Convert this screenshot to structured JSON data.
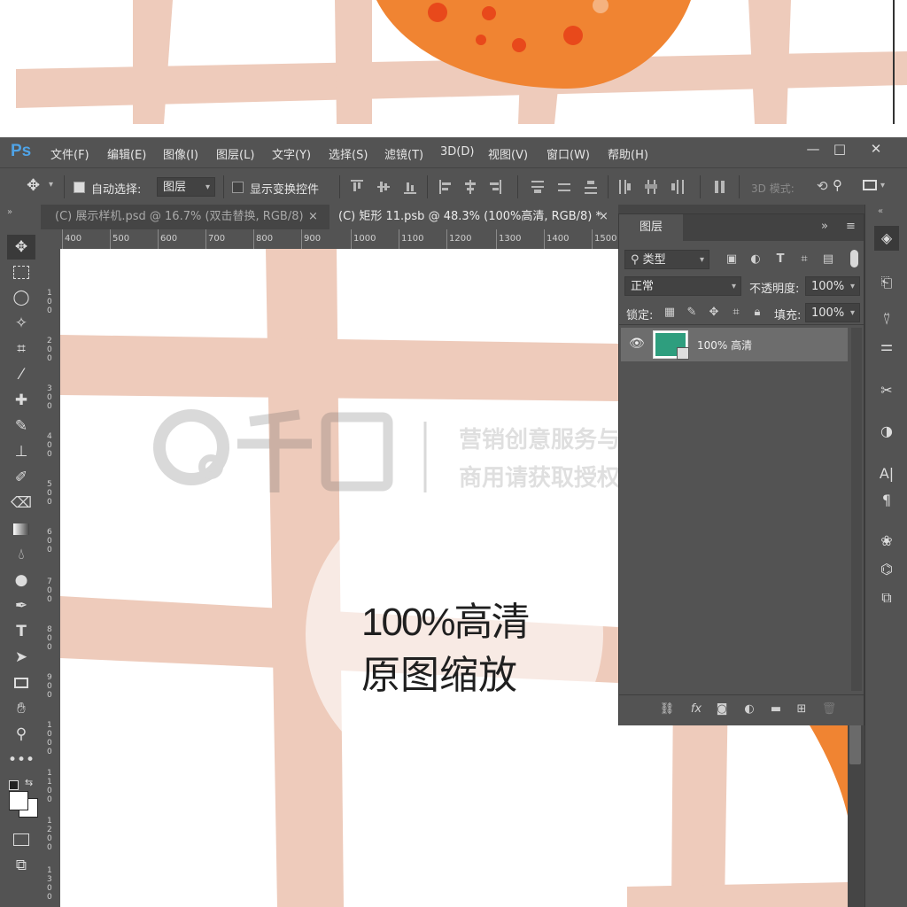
{
  "menubar": {
    "logo": "Ps",
    "items": [
      "文件(F)",
      "编辑(E)",
      "图像(I)",
      "图层(L)",
      "文字(Y)",
      "选择(S)",
      "滤镜(T)",
      "3D(D)",
      "视图(V)",
      "窗口(W)",
      "帮助(H)"
    ],
    "window_controls": [
      "—",
      "□",
      "✕"
    ]
  },
  "options": {
    "auto_select_label": "自动选择:",
    "auto_select_checked": true,
    "auto_select_value": "图层",
    "show_transform_label": "显示变换控件",
    "show_transform_checked": false,
    "mode_3d_label": "3D 模式:"
  },
  "tabs": [
    {
      "label": "(C) 展示样机.psd @ 16.7% (双击替换, RGB/8)",
      "close": "×",
      "active": false
    },
    {
      "label": "(C) 矩形 11.psb @ 48.3% (100%高清, RGB/8) *",
      "close": "×",
      "active": true
    }
  ],
  "ruler": {
    "h_ticks": [
      "400",
      "500",
      "600",
      "700",
      "800",
      "900",
      "1000",
      "1100",
      "1200",
      "1300",
      "1400",
      "1500"
    ],
    "v_ticks": [
      "100",
      "200",
      "300",
      "400",
      "500",
      "600",
      "700",
      "800",
      "900",
      "1000",
      "1100",
      "1200",
      "1300"
    ]
  },
  "canvas": {
    "headline": "100%高清",
    "subline": "原图缩放",
    "watermark_brand": "千图",
    "watermark_line1": "营销创意服务与协作平台",
    "watermark_line2": "商用请获取授权"
  },
  "layers_panel": {
    "title": "图层",
    "filter_label": "类型",
    "blend_mode": "正常",
    "opacity_label": "不透明度:",
    "opacity_value": "100%",
    "lock_label": "锁定:",
    "fill_label": "填充:",
    "fill_value": "100%",
    "layers": [
      {
        "name": "100% 高清",
        "visible": true,
        "thumb_color": "#2e9e7e"
      }
    ]
  },
  "colors": {
    "grid_stripe": "#eecbbb",
    "orange": "#f08432",
    "orange_dot": "#e8491b",
    "panel_bg": "#535353",
    "ps_blue": "#4fa3e6"
  }
}
